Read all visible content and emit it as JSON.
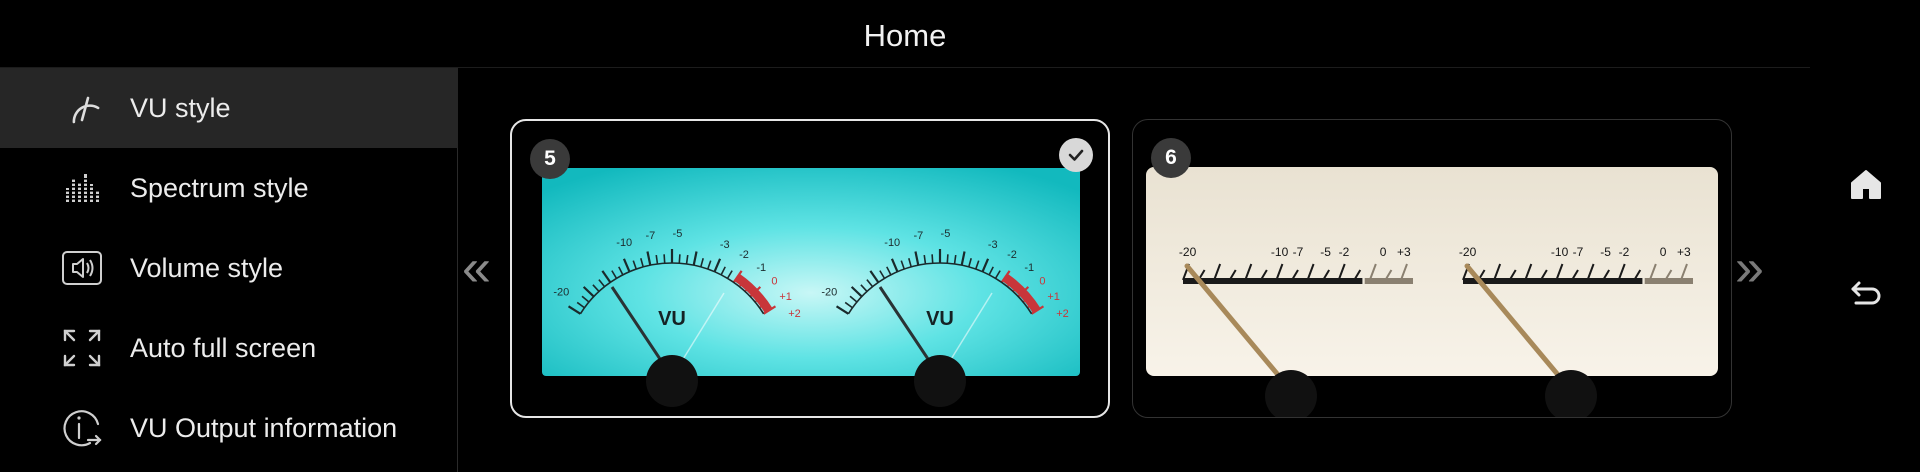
{
  "header": {
    "title": "Home"
  },
  "sidebar": {
    "items": [
      {
        "label": "VU style",
        "icon": "gauge-icon",
        "active": true
      },
      {
        "label": "Spectrum style",
        "icon": "spectrum-icon",
        "active": false
      },
      {
        "label": "Volume style",
        "icon": "volume-icon",
        "active": false
      },
      {
        "label": "Auto full screen",
        "icon": "fullscreen-icon",
        "active": false
      },
      {
        "label": "VU Output information",
        "icon": "info-output-icon",
        "active": false
      }
    ]
  },
  "gallery": {
    "prev_icon": "double-chevron-left-icon",
    "next_icon": "double-chevron-right-icon",
    "styles": [
      {
        "number": "5",
        "selected": true,
        "theme": "cyan",
        "meter_label": "VU",
        "scale_labels": [
          "-20",
          "-10",
          "-7",
          "-5",
          "-3",
          "-2",
          "-1",
          "0",
          "+1",
          "+2"
        ]
      },
      {
        "number": "6",
        "selected": false,
        "theme": "cream",
        "scale_labels": [
          "-20",
          "-10",
          "-7",
          "-5",
          "-2",
          "0",
          "+3"
        ]
      }
    ]
  },
  "right_bar": {
    "home_icon": "home-icon",
    "back_icon": "back-icon"
  },
  "colors": {
    "background": "#000000",
    "sidebar_active": "#262626",
    "cyan_face": "#2fd3d8",
    "cream_face": "#f3ecdd",
    "red_zone": "#c8363a"
  }
}
